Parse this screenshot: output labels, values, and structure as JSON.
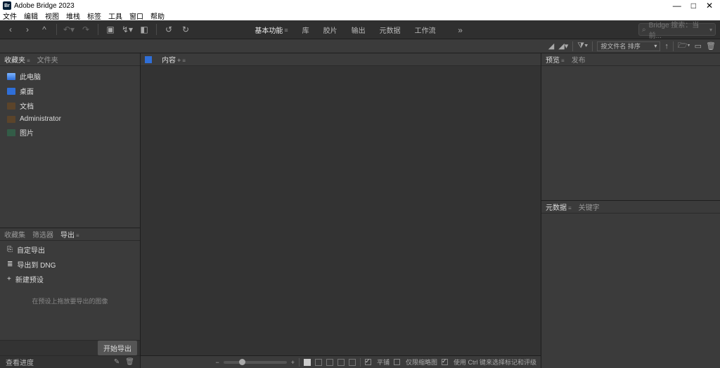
{
  "titlebar": {
    "app_title": "Adobe Bridge 2023"
  },
  "menubar": [
    "文件",
    "编辑",
    "视图",
    "堆栈",
    "标签",
    "工具",
    "窗口",
    "帮助"
  ],
  "workspaces": {
    "items": [
      "基本功能",
      "库",
      "胶片",
      "输出",
      "元数据",
      "工作流"
    ],
    "active_index": 0
  },
  "search": {
    "placeholder": "Bridge 搜索：当前...",
    "icon": "search-icon"
  },
  "sorter": {
    "field_label": "按文件名 排序",
    "icons": [
      "rotate-ccw",
      "rotate-cw",
      "sort-asc",
      "funnel",
      "up-arrow",
      "folder-open",
      "new",
      "trash"
    ]
  },
  "left": {
    "tabs_upper": {
      "active": "收藏夹",
      "secondary": "文件夹"
    },
    "favorites": [
      {
        "label": "此电脑",
        "icon": "pc"
      },
      {
        "label": "桌面",
        "icon": "desktop"
      },
      {
        "label": "文档",
        "icon": "doc"
      },
      {
        "label": "Administrator",
        "icon": "user"
      },
      {
        "label": "图片",
        "icon": "pictures"
      }
    ],
    "tabs_lower": {
      "items": [
        "收藏集",
        "筛选器",
        "导出"
      ],
      "active_index": 2
    },
    "export": {
      "custom_label": "自定导出",
      "dng_label": "导出到 DNG",
      "new_preset_label": "新建预设",
      "drop_hint": "在预设上拖放要导出的图像",
      "start_button": "开始导出",
      "progress_label": "查看进度"
    }
  },
  "center": {
    "tab_label": "内容"
  },
  "bottom": {
    "items_count": "",
    "zoom_minus": "−",
    "zoom_plus": "+",
    "flat_label": "平铺",
    "thumb_only_label": "仅限缩略图",
    "ctrl_label": "使用 Ctrl 键来选择标记和评级"
  },
  "right": {
    "tabs_upper": {
      "items": [
        "预览",
        "发布"
      ],
      "active_index": 0
    },
    "tabs_lower": {
      "items": [
        "元数据",
        "关键字"
      ],
      "active_index": 0
    }
  }
}
